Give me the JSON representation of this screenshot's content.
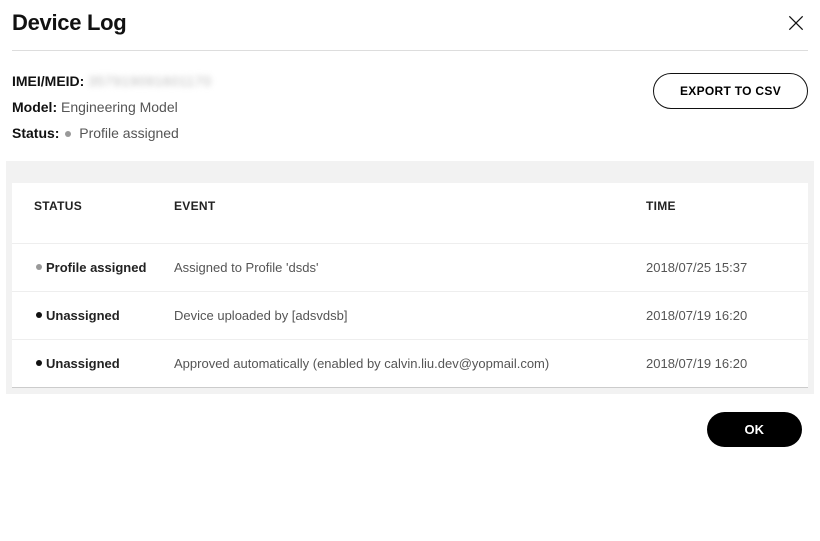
{
  "header": {
    "title": "Device Log"
  },
  "meta": {
    "imei_label": "IMEI/MEID:",
    "imei_value": "357919091601170",
    "model_label": "Model:",
    "model_value": "Engineering Model",
    "status_label": "Status:",
    "status_value": "Profile assigned"
  },
  "buttons": {
    "export": "EXPORT TO CSV",
    "ok": "OK"
  },
  "table": {
    "headers": {
      "status": "STATUS",
      "event": "EVENT",
      "time": "TIME"
    },
    "rows": [
      {
        "status": "Profile assigned",
        "dot": "light",
        "event": "Assigned to Profile 'dsds'",
        "time": "2018/07/25 15:37"
      },
      {
        "status": "Unassigned",
        "dot": "dark",
        "event": "Device uploaded by [adsvdsb]",
        "time": "2018/07/19 16:20"
      },
      {
        "status": "Unassigned",
        "dot": "dark",
        "event": "Approved automatically (enabled by calvin.liu.dev@yopmail.com)",
        "time": "2018/07/19 16:20"
      }
    ]
  }
}
